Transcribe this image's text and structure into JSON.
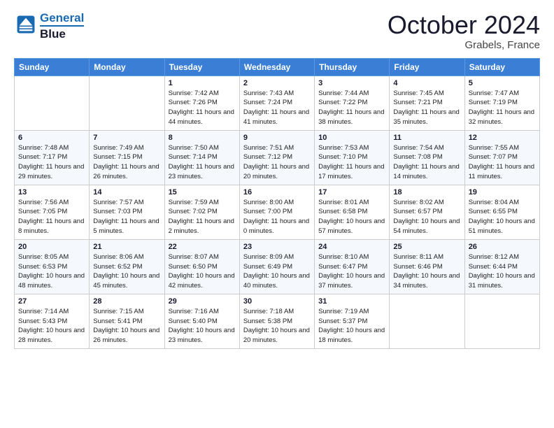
{
  "logo": {
    "line1": "General",
    "line2": "Blue"
  },
  "title": "October 2024",
  "subtitle": "Grabels, France",
  "header_days": [
    "Sunday",
    "Monday",
    "Tuesday",
    "Wednesday",
    "Thursday",
    "Friday",
    "Saturday"
  ],
  "weeks": [
    [
      null,
      null,
      {
        "day": "1",
        "sunrise": "7:42 AM",
        "sunset": "7:26 PM",
        "daylight": "11 hours and 44 minutes."
      },
      {
        "day": "2",
        "sunrise": "7:43 AM",
        "sunset": "7:24 PM",
        "daylight": "11 hours and 41 minutes."
      },
      {
        "day": "3",
        "sunrise": "7:44 AM",
        "sunset": "7:22 PM",
        "daylight": "11 hours and 38 minutes."
      },
      {
        "day": "4",
        "sunrise": "7:45 AM",
        "sunset": "7:21 PM",
        "daylight": "11 hours and 35 minutes."
      },
      {
        "day": "5",
        "sunrise": "7:47 AM",
        "sunset": "7:19 PM",
        "daylight": "11 hours and 32 minutes."
      }
    ],
    [
      {
        "day": "6",
        "sunrise": "7:48 AM",
        "sunset": "7:17 PM",
        "daylight": "11 hours and 29 minutes."
      },
      {
        "day": "7",
        "sunrise": "7:49 AM",
        "sunset": "7:15 PM",
        "daylight": "11 hours and 26 minutes."
      },
      {
        "day": "8",
        "sunrise": "7:50 AM",
        "sunset": "7:14 PM",
        "daylight": "11 hours and 23 minutes."
      },
      {
        "day": "9",
        "sunrise": "7:51 AM",
        "sunset": "7:12 PM",
        "daylight": "11 hours and 20 minutes."
      },
      {
        "day": "10",
        "sunrise": "7:53 AM",
        "sunset": "7:10 PM",
        "daylight": "11 hours and 17 minutes."
      },
      {
        "day": "11",
        "sunrise": "7:54 AM",
        "sunset": "7:08 PM",
        "daylight": "11 hours and 14 minutes."
      },
      {
        "day": "12",
        "sunrise": "7:55 AM",
        "sunset": "7:07 PM",
        "daylight": "11 hours and 11 minutes."
      }
    ],
    [
      {
        "day": "13",
        "sunrise": "7:56 AM",
        "sunset": "7:05 PM",
        "daylight": "11 hours and 8 minutes."
      },
      {
        "day": "14",
        "sunrise": "7:57 AM",
        "sunset": "7:03 PM",
        "daylight": "11 hours and 5 minutes."
      },
      {
        "day": "15",
        "sunrise": "7:59 AM",
        "sunset": "7:02 PM",
        "daylight": "11 hours and 2 minutes."
      },
      {
        "day": "16",
        "sunrise": "8:00 AM",
        "sunset": "7:00 PM",
        "daylight": "11 hours and 0 minutes."
      },
      {
        "day": "17",
        "sunrise": "8:01 AM",
        "sunset": "6:58 PM",
        "daylight": "10 hours and 57 minutes."
      },
      {
        "day": "18",
        "sunrise": "8:02 AM",
        "sunset": "6:57 PM",
        "daylight": "10 hours and 54 minutes."
      },
      {
        "day": "19",
        "sunrise": "8:04 AM",
        "sunset": "6:55 PM",
        "daylight": "10 hours and 51 minutes."
      }
    ],
    [
      {
        "day": "20",
        "sunrise": "8:05 AM",
        "sunset": "6:53 PM",
        "daylight": "10 hours and 48 minutes."
      },
      {
        "day": "21",
        "sunrise": "8:06 AM",
        "sunset": "6:52 PM",
        "daylight": "10 hours and 45 minutes."
      },
      {
        "day": "22",
        "sunrise": "8:07 AM",
        "sunset": "6:50 PM",
        "daylight": "10 hours and 42 minutes."
      },
      {
        "day": "23",
        "sunrise": "8:09 AM",
        "sunset": "6:49 PM",
        "daylight": "10 hours and 40 minutes."
      },
      {
        "day": "24",
        "sunrise": "8:10 AM",
        "sunset": "6:47 PM",
        "daylight": "10 hours and 37 minutes."
      },
      {
        "day": "25",
        "sunrise": "8:11 AM",
        "sunset": "6:46 PM",
        "daylight": "10 hours and 34 minutes."
      },
      {
        "day": "26",
        "sunrise": "8:12 AM",
        "sunset": "6:44 PM",
        "daylight": "10 hours and 31 minutes."
      }
    ],
    [
      {
        "day": "27",
        "sunrise": "7:14 AM",
        "sunset": "5:43 PM",
        "daylight": "10 hours and 28 minutes."
      },
      {
        "day": "28",
        "sunrise": "7:15 AM",
        "sunset": "5:41 PM",
        "daylight": "10 hours and 26 minutes."
      },
      {
        "day": "29",
        "sunrise": "7:16 AM",
        "sunset": "5:40 PM",
        "daylight": "10 hours and 23 minutes."
      },
      {
        "day": "30",
        "sunrise": "7:18 AM",
        "sunset": "5:38 PM",
        "daylight": "10 hours and 20 minutes."
      },
      {
        "day": "31",
        "sunrise": "7:19 AM",
        "sunset": "5:37 PM",
        "daylight": "10 hours and 18 minutes."
      },
      null,
      null
    ]
  ],
  "labels": {
    "sunrise": "Sunrise:",
    "sunset": "Sunset:",
    "daylight": "Daylight:"
  }
}
